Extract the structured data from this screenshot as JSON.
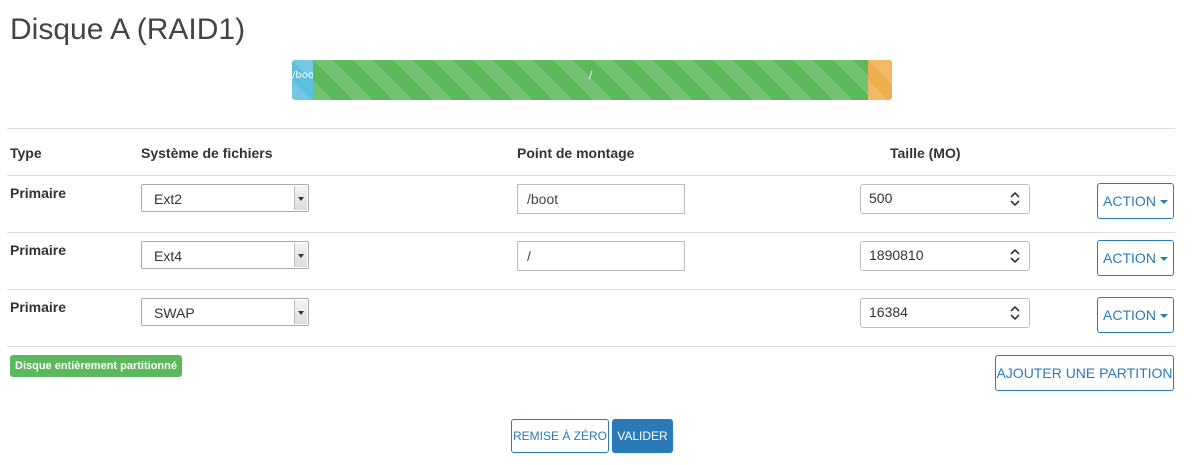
{
  "page": {
    "title": "Disque A (RAID1)"
  },
  "disk_bar": {
    "segments": [
      {
        "label": "/boot",
        "size_mo": 500,
        "color": "#5bc0de"
      },
      {
        "label": "/",
        "size_mo": 1890810,
        "color": "#5cb85c"
      },
      {
        "label": "",
        "size_mo": 16384,
        "color": "#f0ad4e"
      }
    ]
  },
  "table": {
    "headers": {
      "type": "Type",
      "filesystem": "Système de fichiers",
      "mountpoint": "Point de montage",
      "size": "Taille (MO)"
    },
    "rows": [
      {
        "type": "Primaire",
        "filesystem": "Ext2",
        "mountpoint": "/boot",
        "size": "500",
        "action": "ACTION"
      },
      {
        "type": "Primaire",
        "filesystem": "Ext4",
        "mountpoint": "/",
        "size": "1890810",
        "action": "ACTION"
      },
      {
        "type": "Primaire",
        "filesystem": "SWAP",
        "mountpoint": "",
        "size": "16384",
        "action": "ACTION"
      }
    ]
  },
  "status": {
    "badge": "Disque entièrement partitionné",
    "color": "#5cb85c"
  },
  "buttons": {
    "add_partition": "AJOUTER UNE PARTITION",
    "reset": "REMISE À ZÉRO",
    "validate": "VALIDER"
  },
  "colors": {
    "accent": "#2a7ab8"
  }
}
